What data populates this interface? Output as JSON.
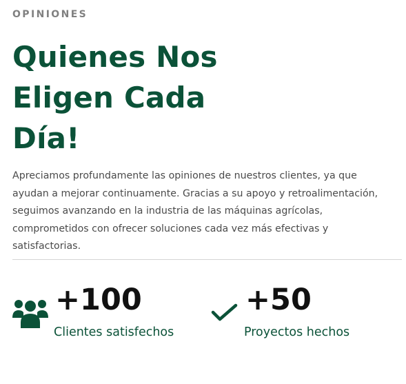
{
  "section": {
    "eyebrow": "OPINIONES",
    "headline_lines": [
      "Quienes Nos",
      "Eligen Cada",
      "Día!"
    ],
    "description_lines": [
      "Apreciamos profundamente las opiniones de nuestros clientes, ya que",
      "ayudan a mejorar continuamente. Gracias a su apoyo y retroalimentación,",
      "seguimos avanzando en la industria de las máquinas agrícolas,",
      "comprometidos con ofrecer soluciones cada vez más efectivas y",
      "satisfactorias."
    ]
  },
  "stats": [
    {
      "icon": "users-icon",
      "number": "+100",
      "label": "Clientes satisfechos"
    },
    {
      "icon": "checkmark-icon",
      "number": "+50",
      "label": "Proyectos hechos"
    }
  ],
  "colors": {
    "brand_green": "#0b5238",
    "eyebrow_gray": "#808080",
    "body_text": "#4a4a4a",
    "number_text": "#111111",
    "divider": "#d4d4d4"
  }
}
